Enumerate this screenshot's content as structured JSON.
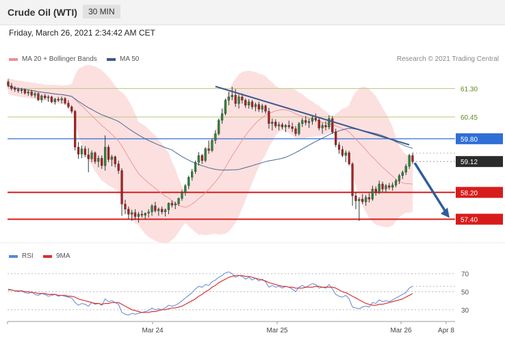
{
  "header": {
    "title": "Crude Oil (WTI)",
    "timeframe": "30 MIN",
    "datetime": "Friday, March 26, 2021 2:34:42 AM CET"
  },
  "legend": {
    "ma20": {
      "label": "MA 20 + Bollinger Bands",
      "color": "#f08f8f"
    },
    "ma50": {
      "label": "MA 50",
      "color": "#3a5a8c"
    },
    "credit": "Research © 2021 Trading Central"
  },
  "rsi_legend": {
    "rsi": {
      "label": "RSI",
      "color": "#5b86d6"
    },
    "ma9": {
      "label": "9MA",
      "color": "#d83030"
    }
  },
  "chart_data": [
    {
      "type": "candlestick",
      "title": "Crude Oil (WTI)",
      "timeframe": "30 MIN",
      "ylim": [
        56.9,
        62.0
      ],
      "x_tick_labels": [
        "Mar 24",
        "Mar 25",
        "Mar 26",
        "Apr 8"
      ],
      "price_levels": [
        {
          "label": "61.30",
          "value": 61.3,
          "kind": "resistance",
          "color": "#b7c77a",
          "text_color": "#5a8a1a"
        },
        {
          "label": "60.45",
          "value": 60.45,
          "kind": "resistance",
          "color": "#b7c77a",
          "text_color": "#5a8a1a"
        },
        {
          "label": "59.80",
          "value": 59.8,
          "kind": "pivot",
          "color": "#2f6fd6"
        },
        {
          "label": "59.12",
          "value": 59.12,
          "kind": "last_price",
          "color": "#2b2b2b"
        },
        {
          "label": "58.20",
          "value": 58.2,
          "kind": "support",
          "color": "#d81c1c"
        },
        {
          "label": "57.40",
          "value": 57.4,
          "kind": "support",
          "color": "#d81c1c"
        }
      ],
      "series": [
        {
          "name": "MA 20 + Bollinger Bands",
          "color": "#f08f8f",
          "band_color": "#fbd6d6"
        },
        {
          "name": "MA 50",
          "color": "#3a5a8c"
        }
      ],
      "candles": [
        [
          61.5,
          61.58,
          61.33,
          61.38
        ],
        [
          61.38,
          61.46,
          61.24,
          61.3
        ],
        [
          61.3,
          61.37,
          61.2,
          61.27
        ],
        [
          61.27,
          61.33,
          61.17,
          61.23
        ],
        [
          61.23,
          61.32,
          61.15,
          61.26
        ],
        [
          61.26,
          61.3,
          61.12,
          61.16
        ],
        [
          61.16,
          61.25,
          61.08,
          61.2
        ],
        [
          61.2,
          61.26,
          61.05,
          61.1
        ],
        [
          61.1,
          61.2,
          61.02,
          61.15
        ],
        [
          61.15,
          61.18,
          60.92,
          60.96
        ],
        [
          60.96,
          61.12,
          60.88,
          61.08
        ],
        [
          61.08,
          61.14,
          60.97,
          61.02
        ],
        [
          61.02,
          61.1,
          60.9,
          61.05
        ],
        [
          61.05,
          61.08,
          60.86,
          60.9
        ],
        [
          60.9,
          61.02,
          60.82,
          60.98
        ],
        [
          60.98,
          61.05,
          60.9,
          60.95
        ],
        [
          60.95,
          61.06,
          60.85,
          61.0
        ],
        [
          61.0,
          61.04,
          60.82,
          60.86
        ],
        [
          60.86,
          60.95,
          60.7,
          60.75
        ],
        [
          60.75,
          60.8,
          60.55,
          60.62
        ],
        [
          60.62,
          60.66,
          59.45,
          59.55
        ],
        [
          59.55,
          59.7,
          59.2,
          59.34
        ],
        [
          59.34,
          59.6,
          59.22,
          59.5
        ],
        [
          59.5,
          59.58,
          59.25,
          59.32
        ],
        [
          59.32,
          59.52,
          58.8,
          59.2
        ],
        [
          59.2,
          59.45,
          59.1,
          59.38
        ],
        [
          59.38,
          59.42,
          59.05,
          59.12
        ],
        [
          59.12,
          59.3,
          58.95,
          59.22
        ],
        [
          59.22,
          59.3,
          58.9,
          59.0
        ],
        [
          59.0,
          59.9,
          58.85,
          59.55
        ],
        [
          59.55,
          59.62,
          59.1,
          59.18
        ],
        [
          59.18,
          59.32,
          58.98,
          59.26
        ],
        [
          59.26,
          59.3,
          58.95,
          59.05
        ],
        [
          59.05,
          59.15,
          58.75,
          58.85
        ],
        [
          58.85,
          58.92,
          57.5,
          57.85
        ],
        [
          57.85,
          57.98,
          57.55,
          57.7
        ],
        [
          57.7,
          57.78,
          57.4,
          57.55
        ],
        [
          57.55,
          57.68,
          57.35,
          57.6
        ],
        [
          57.6,
          57.7,
          57.38,
          57.48
        ],
        [
          57.48,
          57.62,
          57.3,
          57.55
        ],
        [
          57.55,
          57.66,
          57.45,
          57.52
        ],
        [
          57.52,
          57.6,
          57.4,
          57.58
        ],
        [
          57.58,
          57.7,
          57.45,
          57.62
        ],
        [
          57.62,
          57.85,
          57.5,
          57.8
        ],
        [
          57.8,
          57.92,
          57.6,
          57.65
        ],
        [
          57.65,
          57.75,
          57.5,
          57.7
        ],
        [
          57.7,
          57.78,
          57.55,
          57.62
        ],
        [
          57.62,
          57.72,
          57.48,
          57.68
        ],
        [
          57.68,
          57.9,
          57.55,
          57.88
        ],
        [
          57.88,
          57.96,
          57.75,
          57.82
        ],
        [
          57.82,
          57.92,
          57.7,
          57.86
        ],
        [
          57.86,
          58.05,
          57.8,
          58.02
        ],
        [
          58.02,
          58.28,
          57.95,
          58.2
        ],
        [
          58.2,
          58.45,
          58.1,
          58.4
        ],
        [
          58.4,
          58.7,
          58.3,
          58.65
        ],
        [
          58.65,
          58.9,
          58.55,
          58.82
        ],
        [
          58.82,
          59.15,
          58.75,
          59.1
        ],
        [
          59.1,
          59.4,
          59.0,
          59.3
        ],
        [
          59.3,
          59.35,
          59.05,
          59.15
        ],
        [
          59.15,
          59.55,
          59.1,
          59.5
        ],
        [
          59.5,
          59.75,
          59.35,
          59.45
        ],
        [
          59.45,
          59.8,
          59.4,
          59.75
        ],
        [
          59.75,
          60.05,
          59.65,
          59.95
        ],
        [
          59.95,
          60.4,
          59.9,
          60.35
        ],
        [
          60.35,
          60.7,
          60.25,
          60.55
        ],
        [
          60.55,
          61.0,
          60.5,
          60.95
        ],
        [
          60.95,
          61.2,
          60.8,
          61.05
        ],
        [
          61.05,
          61.35,
          60.95,
          61.1
        ],
        [
          61.1,
          61.28,
          60.75,
          60.85
        ],
        [
          60.85,
          61.12,
          60.7,
          61.05
        ],
        [
          61.05,
          61.15,
          60.85,
          60.95
        ],
        [
          60.95,
          61.0,
          60.72,
          60.8
        ],
        [
          60.8,
          60.98,
          60.7,
          60.9
        ],
        [
          60.9,
          60.96,
          60.68,
          60.75
        ],
        [
          60.75,
          60.88,
          60.62,
          60.82
        ],
        [
          60.82,
          60.9,
          60.6,
          60.68
        ],
        [
          60.68,
          60.84,
          60.58,
          60.78
        ],
        [
          60.78,
          60.82,
          60.55,
          60.62
        ],
        [
          60.62,
          60.72,
          60.1,
          60.25
        ],
        [
          60.25,
          60.4,
          60.05,
          60.3
        ],
        [
          60.3,
          60.38,
          60.12,
          60.18
        ],
        [
          60.18,
          60.3,
          60.05,
          60.22
        ],
        [
          60.22,
          60.28,
          60.08,
          60.15
        ],
        [
          60.15,
          60.24,
          60.0,
          60.2
        ],
        [
          60.2,
          60.34,
          60.1,
          60.16
        ],
        [
          60.16,
          60.28,
          60.0,
          60.1
        ],
        [
          60.1,
          60.18,
          59.88,
          59.95
        ],
        [
          59.95,
          60.3,
          59.9,
          60.25
        ],
        [
          60.25,
          60.42,
          60.15,
          60.35
        ],
        [
          60.35,
          60.48,
          60.2,
          60.28
        ],
        [
          60.28,
          60.4,
          60.12,
          60.32
        ],
        [
          60.32,
          60.5,
          60.22,
          60.42
        ],
        [
          60.42,
          60.55,
          60.3,
          60.36
        ],
        [
          60.36,
          60.45,
          60.05,
          60.12
        ],
        [
          60.12,
          60.28,
          59.95,
          60.2
        ],
        [
          60.2,
          60.32,
          60.05,
          60.15
        ],
        [
          60.15,
          60.5,
          60.08,
          60.4
        ],
        [
          60.4,
          60.48,
          59.95,
          60.0
        ],
        [
          60.0,
          60.1,
          59.55,
          59.62
        ],
        [
          59.62,
          59.7,
          59.35,
          59.48
        ],
        [
          59.48,
          59.58,
          59.25,
          59.3
        ],
        [
          59.3,
          59.45,
          59.1,
          59.38
        ],
        [
          59.38,
          59.44,
          59.0,
          59.05
        ],
        [
          59.05,
          59.1,
          57.8,
          58.1
        ],
        [
          58.1,
          58.22,
          57.7,
          57.95
        ],
        [
          57.95,
          58.06,
          57.35,
          58.0
        ],
        [
          58.0,
          58.15,
          57.85,
          57.92
        ],
        [
          57.92,
          58.12,
          57.8,
          58.05
        ],
        [
          58.05,
          58.18,
          57.9,
          58.0
        ],
        [
          58.0,
          58.4,
          57.95,
          58.3
        ],
        [
          58.3,
          58.38,
          58.1,
          58.2
        ],
        [
          58.2,
          58.55,
          58.15,
          58.45
        ],
        [
          58.45,
          58.52,
          58.22,
          58.3
        ],
        [
          58.3,
          58.45,
          58.2,
          58.4
        ],
        [
          58.4,
          58.48,
          58.28,
          58.35
        ],
        [
          58.35,
          58.5,
          58.25,
          58.42
        ],
        [
          58.42,
          58.6,
          58.35,
          58.55
        ],
        [
          58.55,
          58.75,
          58.45,
          58.7
        ],
        [
          58.7,
          58.85,
          58.6,
          58.8
        ],
        [
          58.8,
          59.05,
          58.72,
          58.98
        ],
        [
          58.98,
          59.35,
          58.9,
          59.3
        ],
        [
          59.3,
          59.38,
          59.05,
          59.12
        ]
      ],
      "projection": {
        "from": 59.12,
        "to": 57.4
      }
    },
    {
      "type": "line",
      "title": "RSI",
      "ylim": [
        20,
        80
      ],
      "y_ticks": [
        30,
        50,
        70
      ],
      "series": [
        {
          "name": "RSI",
          "color": "#5b86d6",
          "values": [
            53,
            52,
            51,
            50,
            51,
            49,
            48,
            50,
            47,
            46,
            48,
            47,
            45,
            46,
            47,
            45,
            46,
            45,
            44,
            43,
            38,
            35,
            37,
            36,
            34,
            38,
            36,
            37,
            35,
            42,
            39,
            40,
            38,
            36,
            27,
            25,
            24,
            26,
            25,
            26,
            27,
            28,
            29,
            32,
            30,
            31,
            30,
            32,
            35,
            34,
            35,
            37,
            40,
            43,
            46,
            49,
            53,
            56,
            55,
            58,
            57,
            61,
            63,
            66,
            68,
            71,
            72,
            70,
            66,
            68,
            67,
            64,
            66,
            63,
            65,
            62,
            64,
            61,
            55,
            57,
            55,
            56,
            54,
            56,
            55,
            53,
            50,
            55,
            57,
            55,
            57,
            59,
            58,
            54,
            55,
            54,
            58,
            53,
            47,
            45,
            44,
            46,
            42,
            33,
            32,
            31,
            33,
            34,
            33,
            38,
            37,
            41,
            39,
            40,
            39,
            41,
            43,
            45,
            47,
            49,
            54,
            56
          ]
        },
        {
          "name": "9MA",
          "color": "#d83030",
          "values": [
            52,
            52,
            51,
            51,
            51,
            50,
            50,
            49,
            49,
            48,
            48,
            48,
            47,
            47,
            47,
            46,
            46,
            46,
            45,
            45,
            44,
            42,
            41,
            40,
            39,
            38,
            37,
            37,
            36,
            37,
            37,
            38,
            38,
            38,
            36,
            34,
            32,
            30,
            29,
            28,
            27,
            27,
            27,
            28,
            28,
            29,
            30,
            30,
            31,
            32,
            32,
            33,
            34,
            36,
            38,
            40,
            42,
            45,
            47,
            50,
            52,
            55,
            57,
            60,
            62,
            64,
            66,
            67,
            68,
            68,
            68,
            67,
            67,
            66,
            65,
            64,
            63,
            62,
            60,
            59,
            58,
            57,
            56,
            56,
            55,
            55,
            54,
            54,
            54,
            55,
            55,
            55,
            56,
            56,
            55,
            55,
            55,
            55,
            54,
            52,
            50,
            49,
            47,
            45,
            43,
            41,
            39,
            37,
            36,
            35,
            35,
            36,
            36,
            37,
            38,
            39,
            40,
            41,
            42,
            44,
            46,
            48
          ]
        }
      ]
    }
  ]
}
